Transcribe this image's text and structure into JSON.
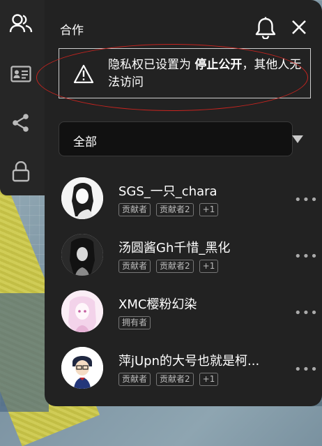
{
  "panel": {
    "title": "合作",
    "notice": {
      "text_prefix": "隐私权已设置为 ",
      "text_bold": "停止公开",
      "text_suffix": "，其他人无法访问"
    },
    "filter": {
      "selected": "全部"
    }
  },
  "sidebar": {
    "items": [
      "collaborators-icon",
      "contact-card-icon",
      "share-icon",
      "lock-icon"
    ]
  },
  "members": [
    {
      "name": "SGS_一只_chara",
      "tags": [
        "贡献者",
        "贡献者2",
        "+1"
      ]
    },
    {
      "name": "汤圆酱Gh千惜_黑化",
      "tags": [
        "贡献者",
        "贡献者2",
        "+1"
      ]
    },
    {
      "name": "XMC樱粉幻染",
      "tags": [
        "拥有者"
      ]
    },
    {
      "name": "萍jUpn的大号也就是柯...",
      "tags": [
        "贡献者",
        "贡献者2",
        "+1"
      ]
    }
  ],
  "more_glyph": "•••",
  "colors": {
    "panel_bg": "#222222",
    "sidebar_bg": "#262626",
    "highlight_oval": "#c8241f"
  }
}
